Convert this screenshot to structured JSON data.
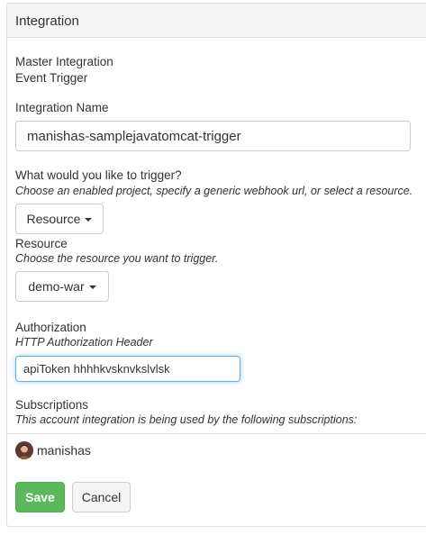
{
  "panel": {
    "title": "Integration"
  },
  "master": {
    "label": "Master Integration",
    "value": "Event Trigger"
  },
  "integration_name": {
    "label": "Integration Name",
    "value": "manishas-samplejavatomcat-trigger"
  },
  "trigger": {
    "label": "What would you like to trigger?",
    "hint": "Choose an enabled project, specify a generic webhook url, or select a resource.",
    "selected": "Resource"
  },
  "resource": {
    "label": "Resource",
    "hint": "Choose the resource you want to trigger.",
    "selected": "demo-war"
  },
  "authorization": {
    "label": "Authorization",
    "hint": "HTTP Authorization Header",
    "value": "apiToken hhhhkvsknvkslvlsk"
  },
  "subscriptions": {
    "label": "Subscriptions",
    "hint": "This account integration is being used by the following subscriptions:",
    "items": [
      {
        "name": "manishas"
      }
    ]
  },
  "actions": {
    "save_label": "Save",
    "cancel_label": "Cancel"
  },
  "colors": {
    "save": "#5cb85c",
    "focus": "#66afe9"
  }
}
